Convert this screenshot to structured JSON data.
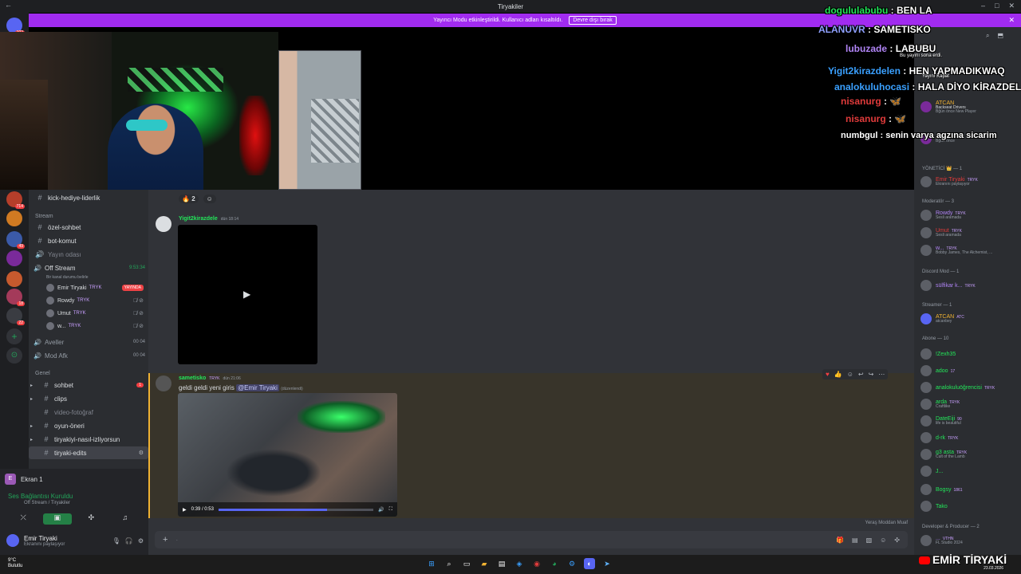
{
  "window": {
    "title": "Tiryakiler"
  },
  "banner": {
    "text": "Yayıncı Modu etkinleştirildi. Kullanıcı adları kısaltıldı.",
    "button": "Devre dışı bırak"
  },
  "servers": {
    "badges": [
      "102",
      "714",
      "49",
      "18",
      "22"
    ]
  },
  "channels": {
    "top": "kick-hediye-liderlik",
    "category_stream": "Stream",
    "c1": "özel-sohbet",
    "c2": "bot-komut",
    "c3": "Yayın odası",
    "voice_name": "Off Stream",
    "voice_timer": "9:53:34",
    "voice_status": "Bir kanal durumu belirle",
    "voice_users": [
      {
        "name": "Emir Tiryaki",
        "tag": "TRYK",
        "live": "YAYINDA"
      },
      {
        "name": "Rowdy",
        "tag": "TRYK"
      },
      {
        "name": "Umut",
        "tag": "TRYK"
      },
      {
        "name": "w...",
        "tag": "TRYK"
      }
    ],
    "c4": "Aveller",
    "c4_count": "00 04",
    "c5": "Mod Afk",
    "c5_count": "00 04",
    "category_general": "Genel",
    "c6": "sohbet",
    "c6_badge": "1",
    "c7": "clips",
    "c8": "video-fotoğraf",
    "c9": "oyun-öneri",
    "c10": "tiryakiyi-nasıl-izliyorsun",
    "c11": "tiryaki-edits"
  },
  "userpanel": {
    "screen": "Ekran 1",
    "voice_connected": "Ses Bağlantısı Kuruldu",
    "voice_location": "Off Stream / Tiryakiler",
    "user_name": "Emir Tiryaki",
    "user_status": "Ekranını paylaşıyor"
  },
  "chat": {
    "reaction_count": "2",
    "msg1_user": "Yigit2kirazdele",
    "msg1_time": "dün 18:14",
    "msg2_user": "sametisko",
    "msg2_tag": "TRYK",
    "msg2_time": "dün 21:06",
    "msg2_text": "geldi geldi yeni giris",
    "msg2_mention": "@Emir Tiryaki",
    "msg2_edited": "(düzenlendi)",
    "video_time": "0:39 / 0:53",
    "video_progress": 0.7,
    "typing": "Yeraş Moddan Muaf"
  },
  "members": {
    "g_admin": "YÖNETİCİ 👑 — 1",
    "admin": [
      {
        "name": "Emir Tiryaki",
        "tag": "TRYK",
        "sub": "Ekranını paylaşıyor",
        "color": "#e03b3b"
      }
    ],
    "g_mod": "Moderatör — 3",
    "mods": [
      {
        "name": "Rowdy",
        "tag": "TRYK",
        "sub": "Sesli aramada",
        "color": "#b084f5"
      },
      {
        "name": "Umut",
        "tag": "TRYK",
        "sub": "Sesli aramada",
        "color": "#e03b3b"
      },
      {
        "name": "w...",
        "tag": "TRYK",
        "sub": "Bobby James, The Alchemist, ...",
        "color": "#b084f5"
      }
    ],
    "g_dmod": "Discord Mod — 1",
    "dmod": [
      {
        "name": "sülfikar k...",
        "tag": "TRYK",
        "sub": "",
        "color": "#b084f5"
      }
    ],
    "g_streamer": "Streamer — 1",
    "streamer": [
      {
        "name": "ATCAN",
        "tag": "ATC",
        "sub": "atcanbey",
        "color": "#f0b232"
      }
    ],
    "g_abone": "Abone — 10",
    "abone": [
      {
        "name": "!Zexh35",
        "tag": "",
        "sub": "",
        "color": "#23e65a"
      },
      {
        "name": "adoo",
        "tag": "17",
        "sub": "",
        "color": "#23e65a"
      },
      {
        "name": "analokuluöğrencisi",
        "tag": "TRYK",
        "sub": "",
        "color": "#23e65a"
      },
      {
        "name": "arda",
        "tag": "TRYK",
        "sub": "Craftlike",
        "color": "#23e65a"
      },
      {
        "name": "DateEiji",
        "tag": "90",
        "sub": "life is beautiful",
        "color": "#23e65a"
      },
      {
        "name": "d-rk",
        "tag": "TRYK",
        "sub": "",
        "color": "#23e65a"
      },
      {
        "name": "g3 asta",
        "tag": "TRYK",
        "sub": "Cult of the Lamb",
        "color": "#23e65a"
      },
      {
        "name": "J...",
        "tag": "",
        "sub": "",
        "color": "#23e65a"
      },
      {
        "name": "Bogsy",
        "tag": "1861",
        "sub": "",
        "color": "#23e65a"
      },
      {
        "name": "Tako",
        "tag": "",
        "sub": "",
        "color": "#23e65a"
      }
    ],
    "g_dev": "Developer & Producer — 2",
    "dev": [
      {
        "name": "...",
        "tag": "VTHN",
        "sub": "FL Studio 2024",
        "color": "#b084f5"
      }
    ],
    "activity": [
      {
        "name": "ATCAN",
        "sub": "Backseat Drivers",
        "sub2": "Bğün önce   New Player"
      },
      {
        "name": "ATCAN",
        "sub": "",
        "sub2": "Bğün önce"
      }
    ]
  },
  "overlay": [
    {
      "user": "dogululabubu",
      "text": "BEN LA",
      "color": "#23e65a"
    },
    {
      "user": "ALANUVR",
      "text": "SAMETISKO",
      "color": "#8fa0ff"
    },
    {
      "user": "lubuzade",
      "text": "LABUBU",
      "color": "#b084f5"
    },
    {
      "user": "Yigit2kirazdelen",
      "text": "HEN YAPMADIKWAQ",
      "color": "#3aa0ff"
    },
    {
      "user": "analokuluhocasi",
      "text": "HALA DİYO KİRAZDELE",
      "color": "#3aa0ff"
    },
    {
      "user": "nisanurg",
      "text": "",
      "color": "#e03b3b"
    },
    {
      "user": "nisanurg",
      "text": "",
      "color": "#e03b3b"
    },
    {
      "user": "numbgul",
      "text": "senin varya agzına sicarim",
      "color": "#fff"
    }
  ],
  "overlay_notes": {
    "a": "Bu yayını sona erdi.",
    "b": "Yayını Kapat"
  },
  "taskbar": {
    "temp": "9°C",
    "weather": "Bulutlu"
  },
  "brand": {
    "text": "EMİR TİRYAKİ",
    "date": "23.03.2026"
  }
}
